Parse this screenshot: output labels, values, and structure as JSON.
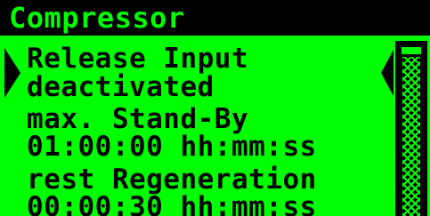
{
  "screen": {
    "title": "Compressor",
    "items": [
      {
        "label": "Release Input",
        "value": "deactivated"
      },
      {
        "label": "max. Stand-By",
        "value": "01:00:00 hh:mm:ss"
      },
      {
        "label": "rest Regeneration",
        "value": "00:00:30 hh:mm:ss"
      }
    ],
    "scroll_fraction": 0.0
  },
  "colors": {
    "background": "#00ff00",
    "foreground": "#000000"
  },
  "icons": {
    "selection_left": "selection-arrow-left-icon",
    "selection_right": "selection-arrow-right-icon"
  }
}
